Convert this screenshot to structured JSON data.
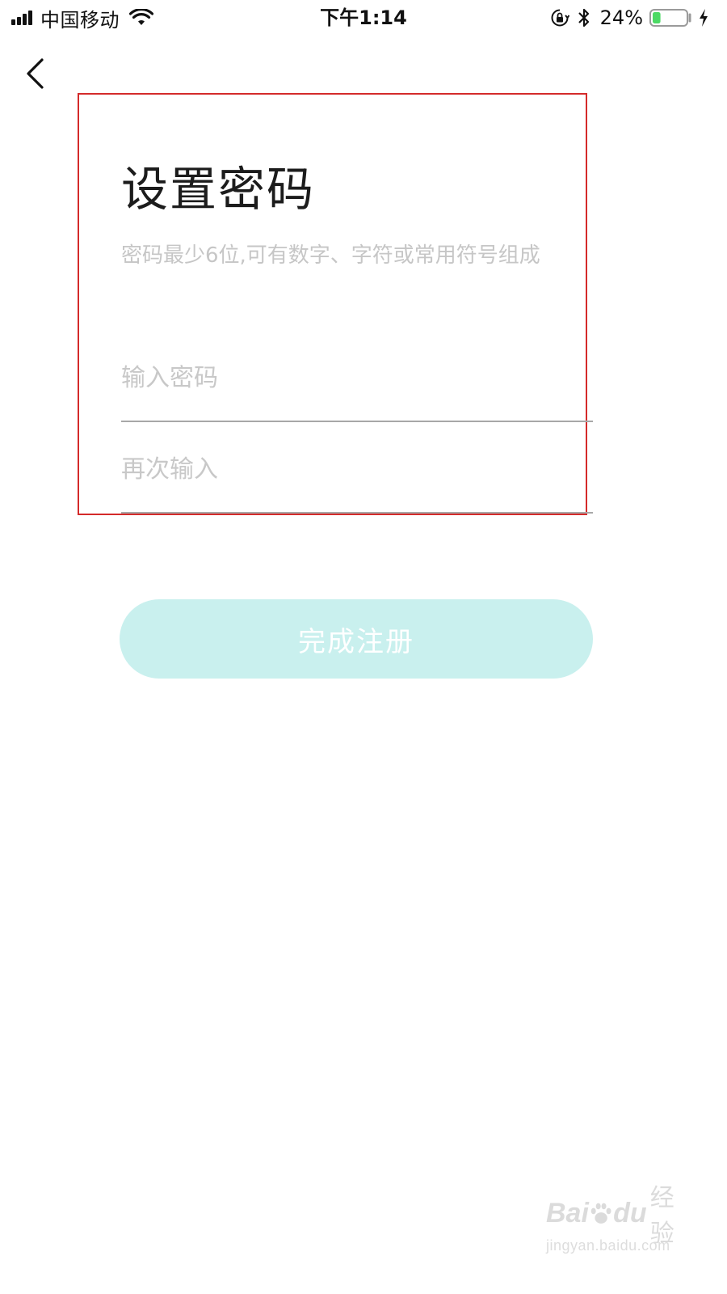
{
  "status_bar": {
    "carrier": "中国移动",
    "time": "下午1:14",
    "battery_percent": "24%",
    "battery_level": 0.24,
    "icons": [
      "signal-icon",
      "wifi-icon",
      "orientation-lock-icon",
      "bluetooth-icon",
      "battery-icon",
      "charging-bolt-icon"
    ]
  },
  "nav": {
    "back_icon": "chevron-left-icon"
  },
  "form": {
    "title": "设置密码",
    "subtitle": "密码最少6位,可有数字、字符或常用符号组成",
    "password_placeholder": "输入密码",
    "confirm_placeholder": "再次输入",
    "password_value": "",
    "confirm_value": "",
    "submit_label": "完成注册"
  },
  "colors": {
    "annotation_border": "#d42a2a",
    "button_background": "#c9f0ee",
    "button_text": "#ffffff",
    "placeholder": "#c8c8c8",
    "battery_fill": "#4cd964"
  },
  "watermark": {
    "brand_left": "Bai",
    "brand_right": "du",
    "brand_cn": "经验",
    "url": "jingyan.baidu.com"
  }
}
